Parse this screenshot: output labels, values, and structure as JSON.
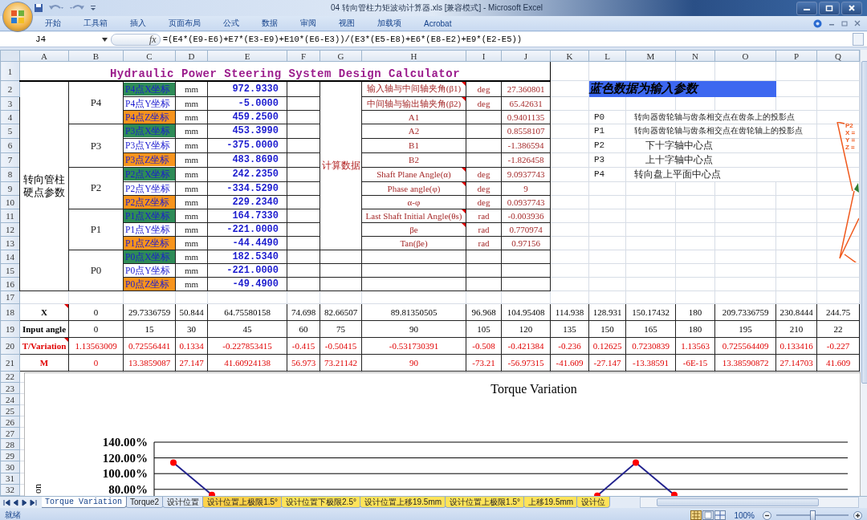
{
  "title_bar": {
    "title": "04 转向管柱力矩波动计算器.xls  [兼容模式] - Microsoft Excel"
  },
  "ribbon": {
    "tabs": [
      {
        "label": "开始"
      },
      {
        "label": "工具箱"
      },
      {
        "label": "插入"
      },
      {
        "label": "页面布局"
      },
      {
        "label": "公式"
      },
      {
        "label": "数据"
      },
      {
        "label": "审阅"
      },
      {
        "label": "视图"
      },
      {
        "label": "加载项"
      },
      {
        "label": "Acrobat"
      }
    ]
  },
  "formula_bar": {
    "name_box": "J4",
    "fx": "fx",
    "formula": "=(E4*(E9-E6)+E7*(E3-E9)+E10*(E6-E3))/(E3*(E5-E8)+E6*(E8-E2)+E9*(E2-E5))"
  },
  "columns": [
    "A",
    "B",
    "C",
    "D",
    "E",
    "F",
    "G",
    "H",
    "I",
    "J",
    "K",
    "L",
    "M",
    "N",
    "O",
    "P",
    "Q"
  ],
  "row_numbers": [
    "1",
    "2",
    "3",
    "4",
    "5",
    "6",
    "7",
    "8",
    "9",
    "10",
    "11",
    "12",
    "13",
    "14",
    "15",
    "16",
    "17",
    "18",
    "19",
    "20",
    "21",
    "22",
    "23",
    "24",
    "25",
    "26",
    "27",
    "28",
    "29",
    "30",
    "31",
    "32"
  ],
  "sheet": {
    "title": "Hydraulic Power Steering System Design Calculator",
    "group_label": "转向管柱硬点参数",
    "points": [
      {
        "name": "P4",
        "coords": [
          {
            "label": "P4点X坐标",
            "color": "#2e8b57",
            "unit": "mm",
            "value": "972.9330"
          },
          {
            "label": "P4点Y坐标",
            "color": "#ffffff",
            "unit": "mm",
            "value": "-5.0000"
          },
          {
            "label": "P4点Z坐标",
            "color": "#f7941d",
            "unit": "mm",
            "value": "459.2500"
          }
        ]
      },
      {
        "name": "P3",
        "coords": [
          {
            "label": "P3点X坐标",
            "color": "#2e8b57",
            "unit": "mm",
            "value": "453.3990"
          },
          {
            "label": "P3点Y坐标",
            "color": "#ffffff",
            "unit": "mm",
            "value": "-375.0000"
          },
          {
            "label": "P3点Z坐标",
            "color": "#f7941d",
            "unit": "mm",
            "value": "483.8690"
          }
        ]
      },
      {
        "name": "P2",
        "coords": [
          {
            "label": "P2点X坐标",
            "color": "#2e8b57",
            "unit": "mm",
            "value": "242.2350"
          },
          {
            "label": "P2点Y坐标",
            "color": "#ffffff",
            "unit": "mm",
            "value": "-334.5290"
          },
          {
            "label": "P2点Z坐标",
            "color": "#f7941d",
            "unit": "mm",
            "value": "229.2340"
          }
        ]
      },
      {
        "name": "P1",
        "coords": [
          {
            "label": "P1点X坐标",
            "color": "#2e8b57",
            "unit": "mm",
            "value": "164.7330"
          },
          {
            "label": "P1点Y坐标",
            "color": "#ffffff",
            "unit": "mm",
            "value": "-221.0000"
          },
          {
            "label": "P1点Z坐标",
            "color": "#f7941d",
            "unit": "mm",
            "value": "-44.4490"
          }
        ]
      },
      {
        "name": "P0",
        "coords": [
          {
            "label": "P0点X坐标",
            "color": "#2e8b57",
            "unit": "mm",
            "value": "182.5340"
          },
          {
            "label": "P0点Y坐标",
            "color": "#ffffff",
            "unit": "mm",
            "value": "-221.0000"
          },
          {
            "label": "P0点Z坐标",
            "color": "#f7941d",
            "unit": "mm",
            "value": "-49.4900"
          }
        ]
      }
    ],
    "calc_label": "计算数据",
    "calc_rows": [
      {
        "label": "输入轴与中间轴夹角(β1)",
        "unit": "deg",
        "value": "27.360801",
        "comment": true
      },
      {
        "label": "中间轴与输出轴夹角(β2)",
        "unit": "deg",
        "value": "65.42631",
        "comment": true
      },
      {
        "label": "A1",
        "value": "0.9401135",
        "comment": false
      },
      {
        "label": "A2",
        "value": "0.8558107",
        "comment": false
      },
      {
        "label": "B1",
        "value": "-1.386594",
        "comment": false
      },
      {
        "label": "B2",
        "value": "-1.826458",
        "comment": false
      },
      {
        "label": "Shaft Plane Angle(α)",
        "unit": "deg",
        "value": "9.0937743",
        "comment": true
      },
      {
        "label": "Phase angle(φ)",
        "unit": "deg",
        "value": "9",
        "comment": true
      },
      {
        "label": "α-φ",
        "unit": "deg",
        "value": "0.0937743",
        "comment": false
      },
      {
        "label": "Last Shaft Initial Angle(θs)",
        "unit": "rad",
        "value": "-0.003936",
        "comment": true
      },
      {
        "label": "βe",
        "unit": "rad",
        "value": "0.770974",
        "comment": true
      },
      {
        "label": "Tan(βe)",
        "unit": "rad",
        "value": "0.97156",
        "comment": false
      }
    ],
    "notice": "蓝色数据为输入参数",
    "legend": [
      {
        "point": "P0",
        "text": "转向器齿轮轴与齿条相交点在齿条上的投影点",
        "kind": "small"
      },
      {
        "point": "P1",
        "text": "转向器齿轮轴与齿条相交点在齿轮轴上的投影点",
        "kind": "small"
      },
      {
        "point": "P2",
        "text": "下十字轴中心点",
        "kind": "indented"
      },
      {
        "point": "P3",
        "text": "上十字轴中心点",
        "kind": "indented"
      },
      {
        "point": "P4",
        "text": "转向盘上平面中心点",
        "kind": "plain"
      }
    ],
    "data_rows": [
      {
        "header": "X",
        "comment": true,
        "color": "#000000",
        "values": [
          "0",
          "29.7336759",
          "50.844",
          "64.75580158",
          "74.698",
          "82.66507",
          "89.81350505",
          "96.968",
          "104.95408",
          "114.938",
          "128.931",
          "150.17432",
          "180",
          "209.7336759",
          "230.8444",
          "244.75"
        ]
      },
      {
        "header": "Input angle",
        "comment": false,
        "color": "#000000",
        "values": [
          "0",
          "15",
          "30",
          "45",
          "60",
          "75",
          "90",
          "105",
          "120",
          "135",
          "150",
          "165",
          "180",
          "195",
          "210",
          "22"
        ]
      },
      {
        "header": "T/Variation",
        "comment": true,
        "color": "#e00000",
        "values": [
          "1.13563009",
          "0.72556441",
          "0.1334",
          "-0.227853415",
          "-0.415",
          "-0.50415",
          "-0.531730391",
          "-0.508",
          "-0.421384",
          "-0.236",
          "0.12625",
          "0.7230839",
          "1.13563",
          "0.725564409",
          "0.133416",
          "-0.227"
        ]
      },
      {
        "header": "M",
        "comment": false,
        "color": "#e00000",
        "values": [
          "0",
          "13.3859087",
          "27.147",
          "41.60924138",
          "56.973",
          "73.21142",
          "90",
          "-73.21",
          "-56.97315",
          "-41.609",
          "-27.147",
          "-13.38591",
          "-6E-15",
          "13.38590872",
          "27.14703",
          "41.609"
        ]
      }
    ],
    "chart_data": {
      "type": "line",
      "title": "Torque Variation",
      "annotations": [
        {
          "text": "on"
        }
      ],
      "categories": [
        null,
        null,
        null,
        null,
        null,
        null,
        null,
        null,
        null,
        null,
        null,
        null,
        null,
        null,
        null,
        null,
        null,
        null
      ],
      "ylim": [
        0.6,
        1.4
      ],
      "grid": true,
      "yticks": [
        {
          "value": 0.8,
          "label": "80.00%"
        },
        {
          "value": 1.0,
          "label": "100.00%"
        },
        {
          "value": 1.2,
          "label": "120.00%"
        },
        {
          "value": 1.4,
          "label": "140.00%"
        }
      ],
      "series": [
        {
          "color": "#23238e",
          "marker": "circle",
          "values": [
            1.14,
            0.73,
            null,
            null,
            null,
            null,
            null,
            null,
            null,
            null,
            null,
            0.72,
            1.14,
            0.73,
            null,
            null,
            null,
            null
          ]
        }
      ]
    }
  },
  "diagram": {
    "labels": [
      "P2",
      "X =",
      "Y =",
      "Z ="
    ]
  },
  "sheet_tabs": [
    {
      "label": "Torque Variation",
      "selected": true,
      "color": "#ffffff"
    },
    {
      "label": "Torque2",
      "selected": false,
      "color": "#dfe8f5"
    },
    {
      "label": "设计位置",
      "selected": false,
      "color": "#dfe8f5"
    },
    {
      "label": "设计位置上极限1.5°",
      "selected": false,
      "color": "#ffd24a"
    },
    {
      "label": "设计位置下极限2.5°",
      "selected": false,
      "color": "#ffe35a"
    },
    {
      "label": "设计位置上移19.5mm",
      "selected": false,
      "color": "#ffe35a"
    },
    {
      "label": "设计位置上极限1.5°",
      "selected": false,
      "color": "#ffe35a"
    },
    {
      "label": "上移19.5mm",
      "selected": false,
      "color": "#ffe35a"
    },
    {
      "label": "设计位",
      "selected": false,
      "color": "#ffe35a"
    }
  ],
  "status_bar": {
    "text": "就绪",
    "zoom": "100%",
    "zoom_slider": {
      "level": 0.5
    }
  }
}
